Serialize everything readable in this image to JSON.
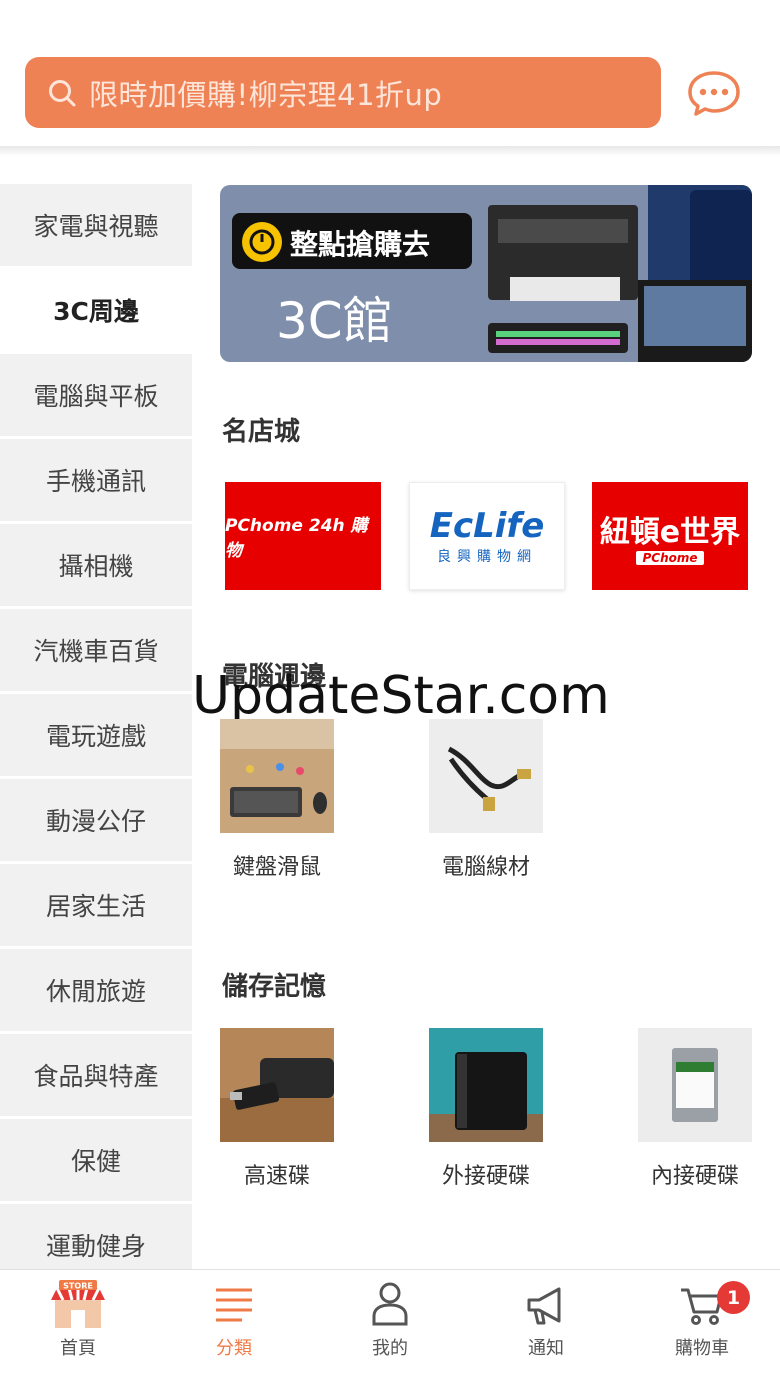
{
  "header": {
    "search_placeholder": "限時加價購!柳宗理41折up",
    "accent_color": "#ef8255"
  },
  "sidebar": {
    "items": [
      {
        "label": "家電與視聽"
      },
      {
        "label": "3C周邊",
        "active": true
      },
      {
        "label": "電腦與平板"
      },
      {
        "label": "手機通訊"
      },
      {
        "label": "攝相機"
      },
      {
        "label": "汽機車百貨"
      },
      {
        "label": "電玩遊戲"
      },
      {
        "label": "動漫公仔"
      },
      {
        "label": "居家生活"
      },
      {
        "label": "休閒旅遊"
      },
      {
        "label": "食品與特產"
      },
      {
        "label": "保健"
      },
      {
        "label": "運動健身"
      }
    ]
  },
  "banner": {
    "title": "整點搶購去",
    "subtitle": "3C館"
  },
  "stores": {
    "title": "名店城",
    "logos": [
      {
        "text": "PChome 24h 購物"
      },
      {
        "text": "EcLife",
        "sub": "良興購物網"
      },
      {
        "text": "紐頓e世界",
        "sub": "PChome"
      }
    ]
  },
  "watermark": "UpdateStar.com",
  "peripherals": {
    "title": "電腦週邊",
    "items": [
      {
        "label": "鍵盤滑鼠"
      },
      {
        "label": "電腦線材"
      }
    ]
  },
  "storage": {
    "title": "儲存記憶",
    "items": [
      {
        "label": "高速碟"
      },
      {
        "label": "外接硬碟"
      },
      {
        "label": "內接硬碟"
      }
    ]
  },
  "bottom_nav": {
    "items": [
      {
        "label": "首頁",
        "icon": "store-icon"
      },
      {
        "label": "分類",
        "icon": "menu-icon",
        "active": true
      },
      {
        "label": "我的",
        "icon": "person-icon"
      },
      {
        "label": "通知",
        "icon": "megaphone-icon"
      },
      {
        "label": "購物車",
        "icon": "cart-icon",
        "badge": "1"
      }
    ]
  }
}
